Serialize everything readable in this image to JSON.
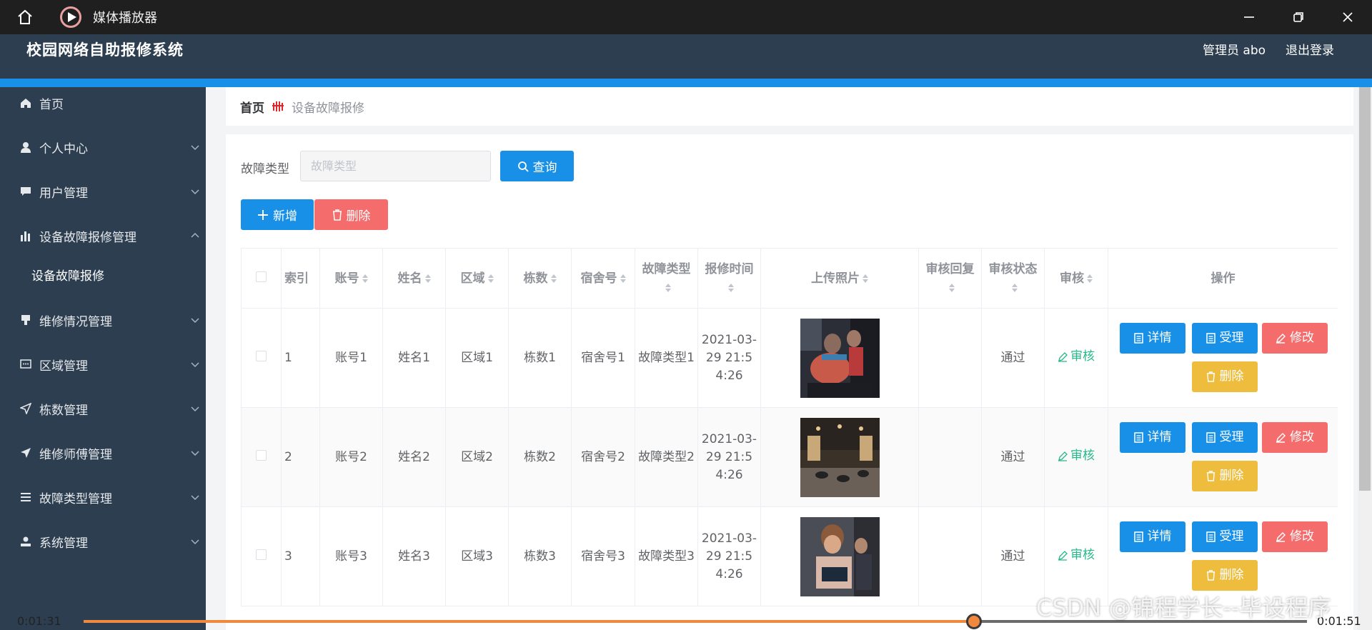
{
  "player": {
    "title": "媒体播放器",
    "time_elapsed": "0:01:31",
    "time_total": "0:01:51",
    "progress_percent": 72.8
  },
  "header": {
    "system_title": "校园网络自助报修系统",
    "admin_label": "管理员 abo",
    "logout_label": "退出登录"
  },
  "sidebar": {
    "items": [
      {
        "label": "首页",
        "icon": "home-icon",
        "expandable": false
      },
      {
        "label": "个人中心",
        "icon": "user-icon",
        "expandable": true
      },
      {
        "label": "用户管理",
        "icon": "chat-icon",
        "expandable": true
      },
      {
        "label": "设备故障报修管理",
        "icon": "bar-chart-icon",
        "expandable": true,
        "expanded": true
      },
      {
        "label": "维修情况管理",
        "icon": "stamp-icon",
        "expandable": true
      },
      {
        "label": "区域管理",
        "icon": "message-icon",
        "expandable": true
      },
      {
        "label": "栋数管理",
        "icon": "send-icon",
        "expandable": true
      },
      {
        "label": "维修师傅管理",
        "icon": "send-icon",
        "expandable": true
      },
      {
        "label": "故障类型管理",
        "icon": "list-icon",
        "expandable": true
      },
      {
        "label": "系统管理",
        "icon": "user-settings-icon",
        "expandable": true
      }
    ],
    "sub_item": "设备故障报修"
  },
  "breadcrumb": {
    "home": "首页",
    "current": "设备故障报修"
  },
  "search": {
    "label": "故障类型",
    "placeholder": "故障类型",
    "query_button": "查询"
  },
  "actions": {
    "add_button": "新增",
    "delete_button": "删除"
  },
  "table": {
    "headers": {
      "index": "索引",
      "account": "账号",
      "name": "姓名",
      "region": "区域",
      "building": "栋数",
      "dorm": "宿舍号",
      "fault_type": "故障类型",
      "report_time": "报修时间",
      "photo": "上传照片",
      "review_reply": "审核回复",
      "review_status": "审核状态",
      "review": "审核",
      "operations": "操作"
    },
    "rows": [
      {
        "index": "1",
        "account": "账号1",
        "name": "姓名1",
        "region": "区域1",
        "building": "栋数1",
        "dorm": "宿舍号1",
        "fault_type": "故障类型1",
        "report_time": "2021-03-29 21:54:26",
        "review_reply": "",
        "review_status": "通过",
        "review_link": "审核"
      },
      {
        "index": "2",
        "account": "账号2",
        "name": "姓名2",
        "region": "区域2",
        "building": "栋数2",
        "dorm": "宿舍号2",
        "fault_type": "故障类型2",
        "report_time": "2021-03-29 21:54:26",
        "review_reply": "",
        "review_status": "通过",
        "review_link": "审核"
      },
      {
        "index": "3",
        "account": "账号3",
        "name": "姓名3",
        "region": "区域3",
        "building": "栋数3",
        "dorm": "宿舍号3",
        "fault_type": "故障类型3",
        "report_time": "2021-03-29 21:54:26",
        "review_reply": "",
        "review_status": "通过",
        "review_link": "审核"
      }
    ],
    "op_labels": {
      "detail": "详情",
      "accept": "受理",
      "edit": "修改",
      "delete": "删除"
    }
  },
  "watermark": "CSDN @锦程学长--毕设程序",
  "colors": {
    "header_bg": "#2d3e50",
    "accent_blue": "#1890e8",
    "danger_red": "#f56c6c",
    "warning_yellow": "#eebd3d",
    "success_green": "#26b88a",
    "progress_orange": "#f0883e"
  }
}
